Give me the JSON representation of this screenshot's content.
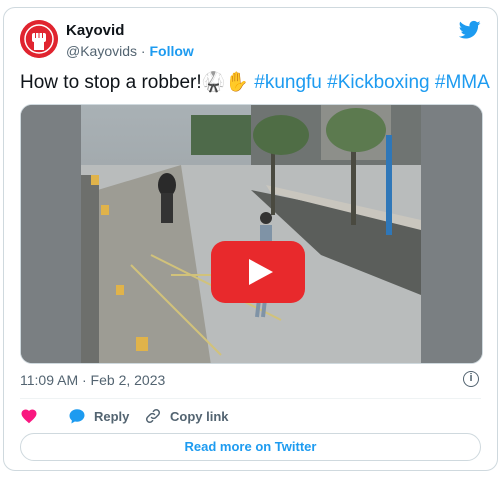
{
  "author": {
    "name": "Kayovid",
    "handle": "@Kayovids",
    "separator": " · ",
    "follow_label": "Follow",
    "avatar_color": "#e0242f"
  },
  "tweet": {
    "text": "How to stop a robber!🥋✋",
    "hashtags": [
      "#kungfu",
      "#Kickboxing",
      "#MMA"
    ],
    "hashtag_color": "#1d9bf0"
  },
  "media": {
    "type": "video",
    "overlay_icon": "play-icon",
    "play_button_color": "#e8292c"
  },
  "timestamp": "11:09 AM · Feb 2, 2023",
  "actions": {
    "like_icon": "heart-icon",
    "reply_label": "Reply",
    "copy_link_label": "Copy link"
  },
  "read_more_label": "Read more on Twitter",
  "brand_icon": "twitter-bird-icon"
}
